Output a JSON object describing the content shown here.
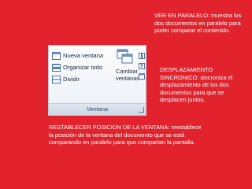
{
  "ribbon": {
    "buttons": {
      "new_window": "Nueva ventana",
      "arrange_all": "Organizar todo",
      "split": "Dividir",
      "switch_windows_line1": "Cambiar",
      "switch_windows_line2": "ventanas"
    },
    "group_label": "Ventana"
  },
  "callouts": {
    "parallel": [
      "VER EN PARALELO: muestra los",
      "dos documentos en paralelo para",
      "poder comparar el contenido."
    ],
    "sync_scroll": [
      "DESPLAZAMIENTO",
      "SINCRONICO: sincroniza el",
      "desplazamiento de los dos",
      "documentos para que se",
      "desplacen juntos."
    ],
    "reset_position": [
      "RESTABLECER POSICION DE LA VENTANA: reestablece",
      "la posición  de la ventana del documento que se está",
      "comparando en paralelo para que compartan la pantalla."
    ]
  },
  "colors": {
    "background": "#e2232d",
    "text": "#ffffff"
  }
}
